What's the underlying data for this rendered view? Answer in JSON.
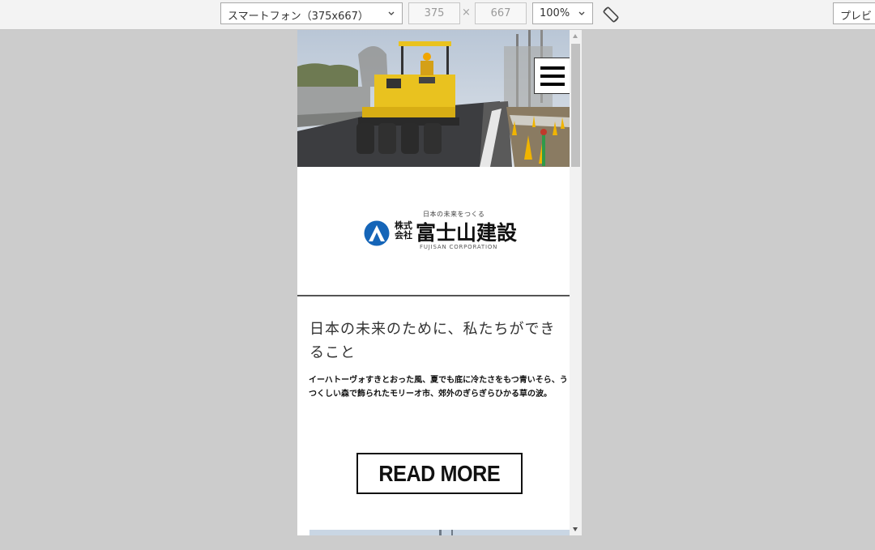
{
  "toolbar": {
    "device_selected": "スマートフォン（375x667）",
    "width_value": "375",
    "height_value": "667",
    "dim_separator": "×",
    "zoom_selected": "100%",
    "preview_label": "プレビ"
  },
  "site": {
    "tagline": "日本の未来をつくる",
    "kabushiki": "株式会社",
    "company_name": "富士山建設",
    "romaji": "FUJISAN CORPORATION",
    "headline": "日本の未来のために、私たちができること",
    "body": "イーハトーヴォすきとおった風、夏でも底に冷たさをもつ青いそら、うつくしい森で飾られたモリーオ市、郊外のぎらぎらひかる草の波。",
    "read_more": "READ MORE"
  },
  "colors": {
    "toolbar_bg": "#f3f3f3",
    "canvas_bg": "#cccccc",
    "logo_blue": "#1565b8",
    "roller_yellow": "#e9c21f"
  }
}
